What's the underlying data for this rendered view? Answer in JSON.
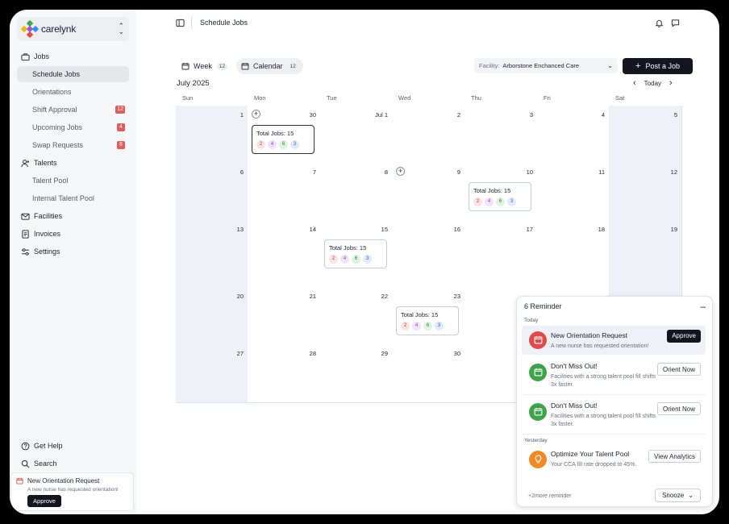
{
  "app": {
    "brand": "carelynk",
    "page_title": "Schedule Jobs"
  },
  "sidebar": {
    "jobs": "Jobs",
    "schedule_jobs": "Schedule Jobs",
    "orientations": "Orientations",
    "shift_approval": "Shift Approval",
    "shift_approval_badge": "12",
    "upcoming_jobs": "Upcoming Jobs",
    "upcoming_jobs_badge": "4",
    "swap_requests": "Swap Requests",
    "swap_requests_badge": "8",
    "talents": "Talents",
    "talent_pool": "Talent Pool",
    "internal_talent_pool": "Internal Talent Pool",
    "facilities": "Facilities",
    "invoices": "Invoices",
    "settings": "Settings",
    "get_help": "Get Help",
    "search": "Search",
    "toast": {
      "title": "New Orientation Request",
      "desc": "A new nurse has requested orientation!",
      "button": "Approve"
    }
  },
  "toolbar": {
    "week_label": "Week",
    "week_count": "12",
    "calendar_label": "Calendar",
    "calendar_count": "12",
    "facility_label": "Facility:",
    "facility_value": "Arborstone Enchanced Care",
    "post_job": "Post a Job",
    "month": "July 2025",
    "today": "Today"
  },
  "weekdays": [
    "Sun",
    "Mon",
    "Tue",
    "Wed",
    "Thu",
    "Fri",
    "Sat"
  ],
  "weeks": [
    [
      "1",
      "30",
      "Jul 1",
      "2",
      "3",
      "4",
      "5"
    ],
    [
      "6",
      "7",
      "8",
      "9",
      "10",
      "11",
      "12"
    ],
    [
      "13",
      "14",
      "15",
      "16",
      "17",
      "18",
      "19"
    ],
    [
      "20",
      "21",
      "22",
      "23",
      "",
      "",
      ""
    ],
    [
      "27",
      "28",
      "29",
      "30",
      "",
      "",
      ""
    ]
  ],
  "job_summary": {
    "label": "Total Jobs: 15",
    "counts": [
      "2",
      "4",
      "6",
      "3"
    ]
  },
  "colors": {
    "dark": "#14161f",
    "badge": "#e05d5d",
    "red": "#e04b4b",
    "green": "#3fa34d",
    "orange": "#f08a24"
  },
  "reminders": {
    "title": "6 Reminder",
    "today": "Today",
    "yesterday": "Yesterday",
    "items": [
      {
        "title": "New Orientation Request",
        "desc": "A new nurse has requested orientation!",
        "button": "Approve"
      },
      {
        "title": "Don't Miss Out!",
        "desc": "Facilities with a strong talent pool fill shifts 3x faster.",
        "button": "Orient Now"
      },
      {
        "title": "Don't Miss Out!",
        "desc": "Facilities with a strong talent pool fill shifts 3x faster.",
        "button": "Orient Now"
      },
      {
        "title": "Optimize Your Talent Pool",
        "desc": "Your CCA fill rate dropped to 45%.",
        "button": "View Analytics"
      }
    ],
    "more": "+2more reminder",
    "snooze": "Snooze"
  }
}
